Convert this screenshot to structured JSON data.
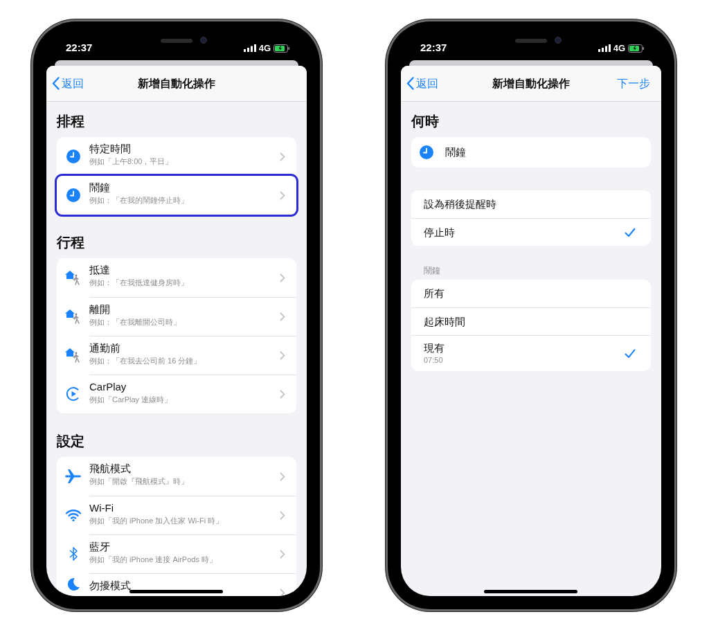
{
  "phones": [
    {
      "status": {
        "time": "22:37",
        "network": "4G"
      },
      "nav": {
        "back": "返回",
        "title": "新增自動化操作"
      },
      "sections": [
        {
          "title": "排程",
          "kind": "triggers",
          "rows": [
            {
              "kind": "clock",
              "title": "特定時間",
              "subtitle": "例如「上午8:00，平日」",
              "highlighted": false
            },
            {
              "kind": "clock",
              "title": "鬧鐘",
              "subtitle": "例如：「在我的鬧鐘停止時」",
              "highlighted": true
            }
          ]
        },
        {
          "title": "行程",
          "kind": "triggers",
          "rows": [
            {
              "kind": "location",
              "title": "抵達",
              "subtitle": "例如：「在我抵達健身房時」",
              "highlighted": false
            },
            {
              "kind": "location",
              "title": "離開",
              "subtitle": "例如：「在我離開公司時」",
              "highlighted": false
            },
            {
              "kind": "location",
              "title": "通勤前",
              "subtitle": "例如：「在我去公司前 16 分鐘」",
              "highlighted": false
            },
            {
              "kind": "carplay",
              "title": "CarPlay",
              "subtitle": "例如「CarPlay 連線時」",
              "highlighted": false
            }
          ]
        },
        {
          "title": "設定",
          "kind": "triggers",
          "rows": [
            {
              "kind": "airplane",
              "title": "飛航模式",
              "subtitle": "例如「開啟『飛航模式』時」",
              "highlighted": false
            },
            {
              "kind": "wifi",
              "title": "Wi-Fi",
              "subtitle": "例如「我的 iPhone 加入住家 Wi-Fi 時」",
              "highlighted": false
            },
            {
              "kind": "bluetooth",
              "title": "藍牙",
              "subtitle": "例如「我的 iPhone 連接 AirPods 時」",
              "highlighted": false
            },
            {
              "kind": "moon",
              "title": "勿擾模式",
              "highlighted": false
            }
          ]
        }
      ]
    },
    {
      "status": {
        "time": "22:37",
        "network": "4G"
      },
      "nav": {
        "back": "返回",
        "title": "新增自動化操作",
        "action": "下一步"
      },
      "sections": [
        {
          "title": "何時",
          "kind": "summary",
          "rows": [
            {
              "kind": "clock",
              "title": "鬧鐘"
            }
          ]
        },
        {
          "kind": "options",
          "rows": [
            {
              "title": "設為稍後提醒時",
              "checked": false
            },
            {
              "title": "停止時",
              "checked": true
            }
          ]
        },
        {
          "label": "鬧鐘",
          "kind": "options",
          "rows": [
            {
              "title": "所有",
              "checked": false
            },
            {
              "title": "起床時間",
              "checked": false
            },
            {
              "title": "現有",
              "subtitle": "07:50",
              "checked": true
            }
          ]
        }
      ]
    }
  ]
}
